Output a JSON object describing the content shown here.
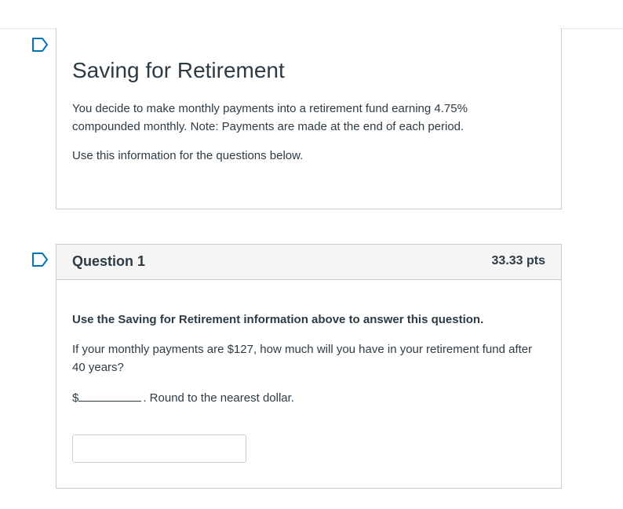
{
  "intro": {
    "title": "Saving for Retirement",
    "paragraph1": "You decide to make monthly payments into a retirement fund earning 4.75% compounded monthly.  Note: Payments are made at the end of each period.",
    "paragraph2": "Use this information for the questions below."
  },
  "question": {
    "title": "Question 1",
    "points": "33.33 pts",
    "lead": "Use the Saving for Retirement information above to answer this question.",
    "text": "If your monthly payments are $127, how much will you have in your retirement fund after 40 years?",
    "currency_prefix": "$",
    "instruction_suffix": ".  Round to the nearest dollar.",
    "answer_value": ""
  },
  "icons": {
    "flag": "flag-question-icon"
  },
  "colors": {
    "text": "#2d3b45",
    "border": "#c7cdd1",
    "header_bg": "#f5f5f5",
    "flag_outline": "#0374b5"
  }
}
